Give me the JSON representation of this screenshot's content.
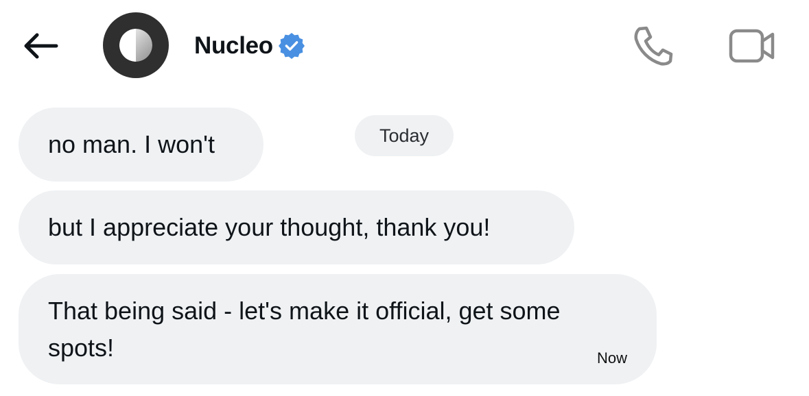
{
  "header": {
    "contact_name": "Nucleo",
    "verified": true,
    "icons": {
      "back": "arrow-left-icon",
      "verified": "verified-badge-icon",
      "call": "phone-icon",
      "video": "video-camera-icon"
    },
    "verified_color": "#4a90e2"
  },
  "conversation": {
    "date_separator": "Today",
    "messages": [
      {
        "text": "no man. I won't"
      },
      {
        "text": "but I appreciate your thought, thank you!"
      },
      {
        "text": "That being said - let's make it official, get some spots!",
        "time": "Now"
      }
    ]
  },
  "colors": {
    "bubble_bg": "#eff1f3",
    "text": "#0f1419",
    "icon_gray": "#8a8a8a"
  }
}
